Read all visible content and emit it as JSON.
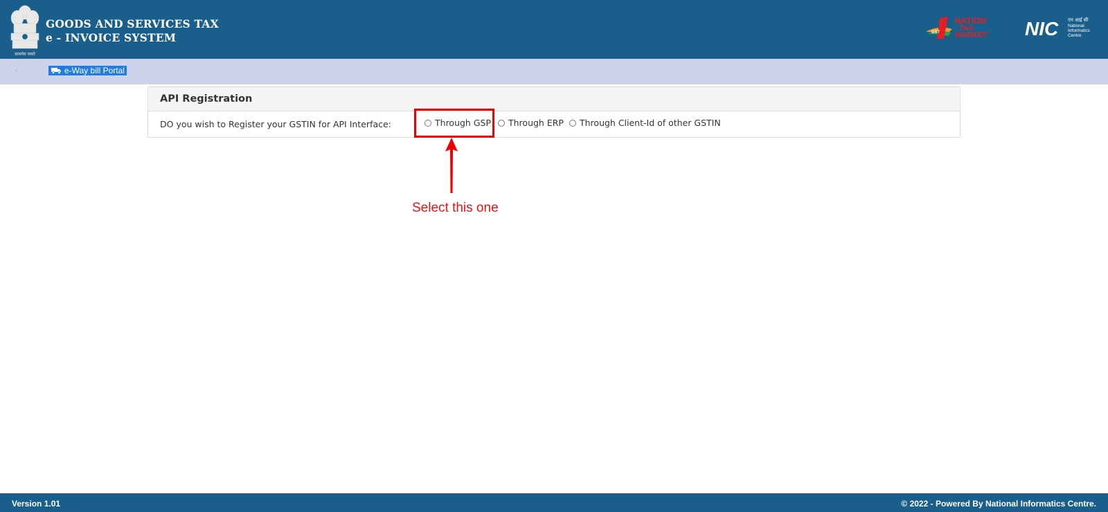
{
  "header": {
    "title_line1": "GOODS AND SERVICES TAX",
    "title_line2": "e - INVOICE SYSTEM",
    "emblem_caption": "सत्यमेव जयते",
    "logo_ntm_line1": "NATION",
    "logo_ntm_line2": "TAX",
    "logo_ntm_line3": "MARKET",
    "logo_ntm_badge": "GST",
    "logo_nic_mark": "NIC",
    "logo_nic_hindi": "एन आई सी",
    "logo_nic_line1": "National",
    "logo_nic_line2": "Informatics",
    "logo_nic_line3": "Centre"
  },
  "nav": {
    "link_label": "e-Way bill Portal",
    "link_icon": "truck-icon",
    "marker": "-"
  },
  "panel": {
    "title": "API Registration",
    "question": "DO you wish to Register your GSTIN for API Interface:",
    "options": [
      {
        "label": "Through GSP",
        "selected": false
      },
      {
        "label": "Through ERP",
        "selected": false
      },
      {
        "label": "Through Client-Id of other GSTIN",
        "selected": false
      }
    ]
  },
  "annotation": {
    "text": "Select this one",
    "color": "#ee1111"
  },
  "footer": {
    "version": "Version 1.01",
    "copyright": "© 2022 - Powered By National Informatics Centre."
  },
  "colors": {
    "header_bg": "#1a5f8b",
    "nav_bg": "#cdd3ea",
    "link_bg": "#1f7be6"
  }
}
